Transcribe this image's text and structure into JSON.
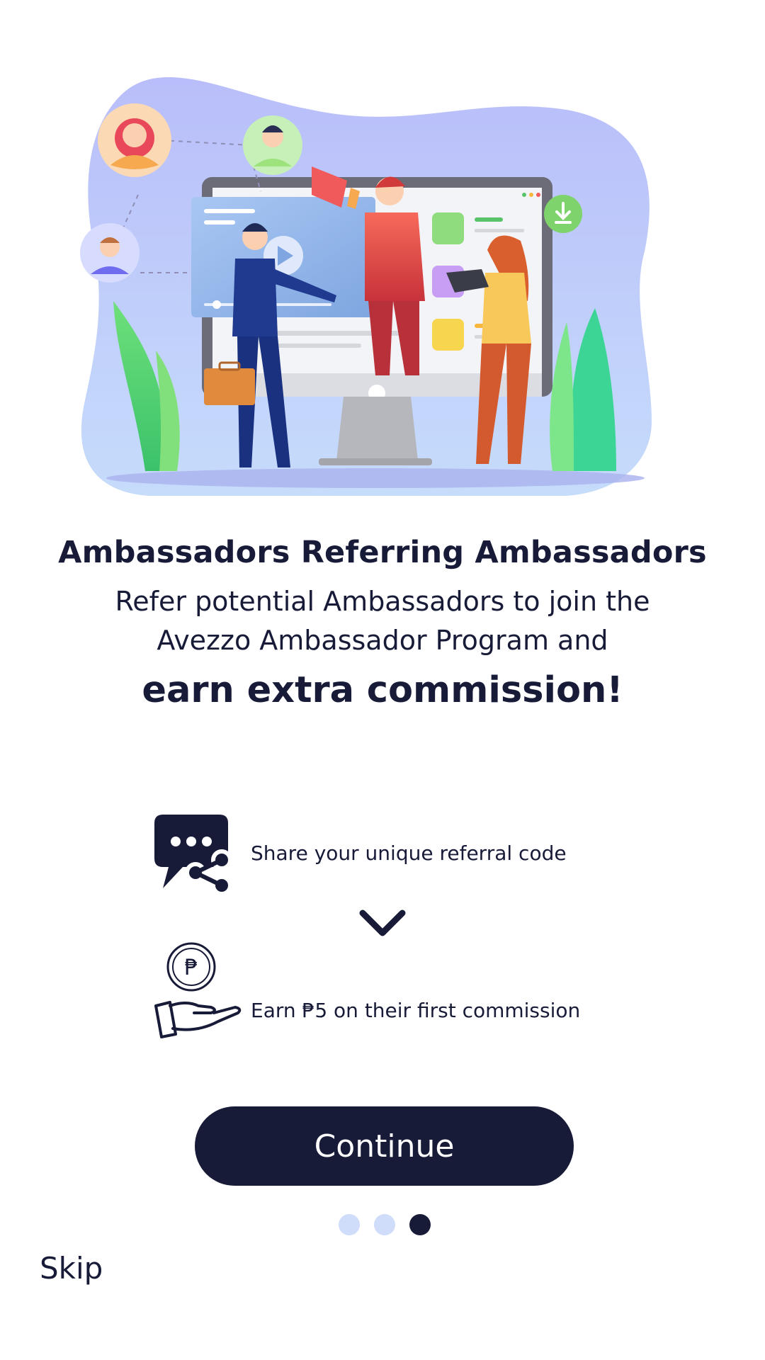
{
  "hero": {
    "illustration": "ambassador-referral-illustration"
  },
  "content": {
    "title": "Ambassadors Referring Ambassadors",
    "subtitle": "Refer potential Ambassadors to join the Avezzo Ambassador Program and",
    "emphasis": "earn extra commission!"
  },
  "steps": [
    {
      "icon": "share-chat-icon",
      "text": "Share your unique referral code"
    },
    {
      "icon": "peso-coin-hand-icon",
      "text": "Earn ₱5 on their first commission",
      "coin_symbol": "₱"
    }
  ],
  "arrow_icon": "chevron-down-icon",
  "actions": {
    "continue_label": "Continue",
    "skip_label": "Skip"
  },
  "pagination": {
    "total": 3,
    "active": 3
  },
  "colors": {
    "primary": "#181b38",
    "dot_inactive": "#cfdcfa",
    "blob": "#bcc4fa",
    "background": "#ffffff"
  }
}
